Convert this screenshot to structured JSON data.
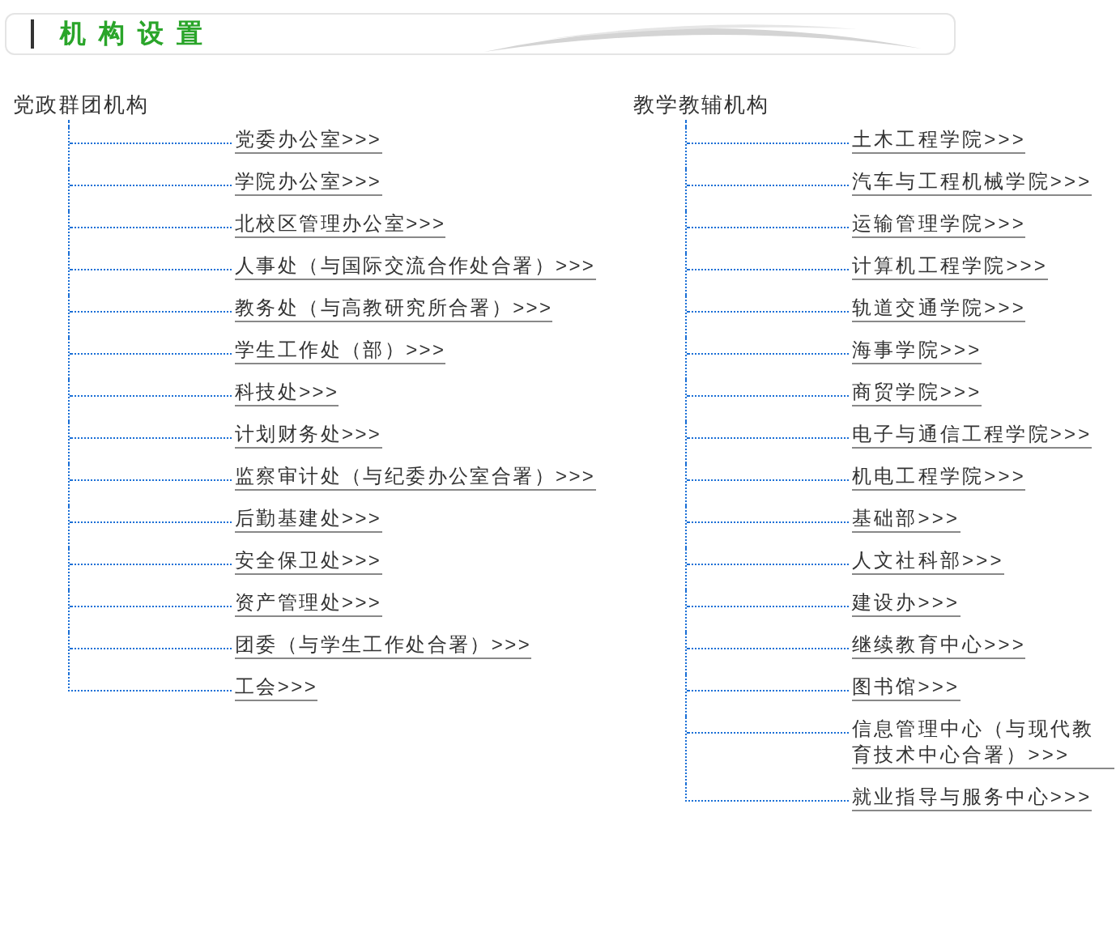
{
  "title": "机构设置",
  "columns": [
    {
      "heading": "党政群团机构",
      "items": [
        "党委办公室>>>",
        "学院办公室>>>",
        "北校区管理办公室>>>",
        "人事处（与国际交流合作处合署）>>>",
        "教务处（与高教研究所合署）>>>",
        "学生工作处（部）>>>",
        "科技处>>>",
        "计划财务处>>>",
        "监察审计处（与纪委办公室合署）>>>",
        "后勤基建处>>>",
        "安全保卫处>>>",
        "资产管理处>>>",
        "团委（与学生工作处合署）>>>",
        "工会>>>"
      ]
    },
    {
      "heading": "教学教辅机构",
      "items": [
        "土木工程学院>>>",
        "汽车与工程机械学院>>>",
        "运输管理学院>>>",
        "计算机工程学院>>>",
        "轨道交通学院>>>",
        "海事学院>>>",
        "商贸学院>>>",
        "电子与通信工程学院>>>",
        "机电工程学院>>>",
        "基础部>>>",
        "人文社科部>>>",
        "建设办>>>",
        "继续教育中心>>>",
        "图书馆>>>",
        "信息管理中心（与现代教育技术中心合署）>>>",
        "就业指导与服务中心>>>"
      ]
    }
  ]
}
